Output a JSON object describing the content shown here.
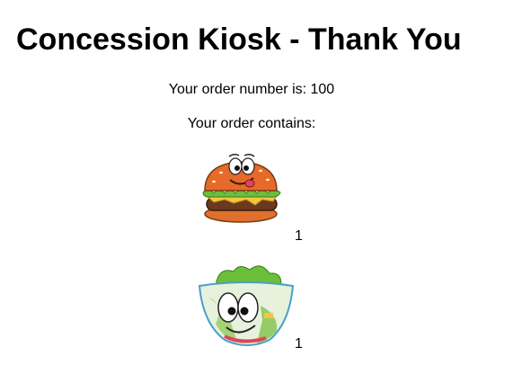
{
  "page": {
    "title": "Concession Kiosk - Thank You",
    "order_number_text": "Your order number is: 100",
    "order_contains_text": "Your order contains:"
  },
  "order": {
    "items": [
      {
        "icon": "burger-icon",
        "quantity": "1"
      },
      {
        "icon": "salad-bowl-icon",
        "quantity": "1"
      }
    ]
  },
  "colors": {
    "bun": "#e86a2a",
    "lettuce": "#6bbf3a",
    "patty": "#6b3a1e",
    "bowl_rim": "#4aa0c8"
  }
}
